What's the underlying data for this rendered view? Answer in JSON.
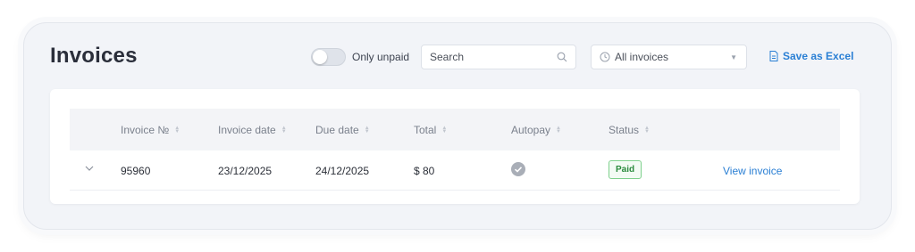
{
  "header": {
    "title": "Invoices",
    "toggle": {
      "label": "Only unpaid",
      "checked": false
    },
    "search": {
      "placeholder": "Search",
      "value": ""
    },
    "filter": {
      "selected": "All invoices"
    },
    "export_label": "Save as Excel"
  },
  "table": {
    "columns": [
      "Invoice №",
      "Invoice date",
      "Due date",
      "Total",
      "Autopay",
      "Status"
    ],
    "rows": [
      {
        "invoice_no": "95960",
        "invoice_date": "23/12/2025",
        "due_date": "24/12/2025",
        "total": "$ 80",
        "autopay": true,
        "status": "Paid",
        "action": "View invoice"
      }
    ]
  },
  "colors": {
    "accent": "#2a7fd4",
    "status_paid": "#2a8a3c",
    "card_bg": "#f2f4f8"
  }
}
